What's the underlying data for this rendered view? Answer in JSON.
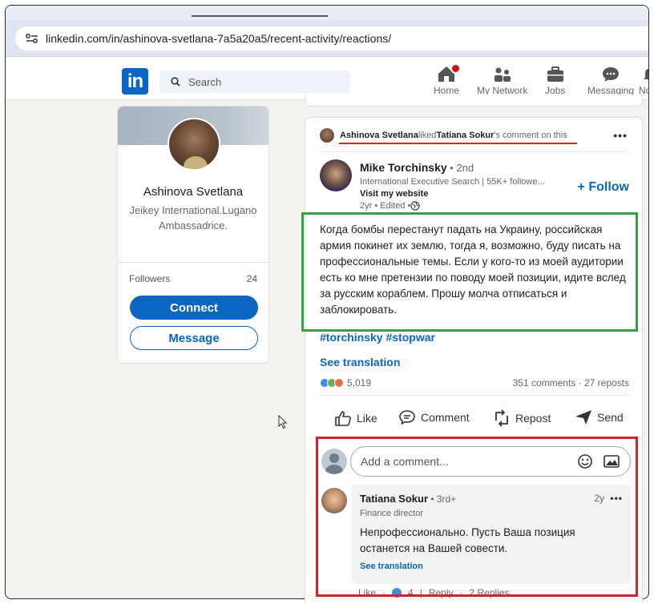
{
  "browser": {
    "url": "linkedin.com/in/ashinova-svetlana-7a5a20a5/recent-activity/reactions/"
  },
  "nav": {
    "search_placeholder": "Search",
    "items": [
      {
        "label": "Home"
      },
      {
        "label": "My Network"
      },
      {
        "label": "Jobs"
      },
      {
        "label": "Messaging"
      },
      {
        "label": "Notif"
      }
    ]
  },
  "profile": {
    "name": "Ashinova Svetlana",
    "headline": "Jeikey International.Lugano Ambassadrice.",
    "followers_label": "Followers",
    "followers_count": "24",
    "connect_label": "Connect",
    "message_label": "Message"
  },
  "post": {
    "activity": {
      "actor": "Ashinova Svetlana",
      "verb": " liked ",
      "target": "Tatiana Sokur",
      "suffix": "'s comment on this"
    },
    "author": {
      "name": "Mike Torchinsky",
      "degree": " • 2nd",
      "subtitle": "International Executive Search | 55K+ followe...",
      "website": "Visit my website",
      "time": "2yr • Edited • "
    },
    "follow_label": "+ Follow",
    "text": "Когда бомбы перестанут падать на Украину, российская армия покинет их землю, тогда я, возможно, буду писать на профессиональные темы. Если у кого-то из моей аудитории есть ко мне претензии по поводу моей позиции, идите вслед за русским кораблем. Прошу молча отписаться и заблокировать.",
    "hashtags": "#torchinsky #stopwar",
    "see_translation": "See translation",
    "reactions_count": "5,019",
    "comments_reposts": "351 comments · 27 reposts",
    "actions": {
      "like": "Like",
      "comment": "Comment",
      "repost": "Repost",
      "send": "Send"
    },
    "comment_placeholder": "Add a comment...",
    "reply": {
      "name": "Tatiana Sokur",
      "degree": " • 3rd+",
      "time": "2y",
      "role": "Finance director",
      "text": "Непрофессионально. Пусть Ваша позиция останется на Вашей совести.",
      "see_translation": "See translation",
      "like_label": "Like",
      "like_count": "4",
      "reply_label": "Reply",
      "replies": "2 Replies"
    }
  },
  "colors": {
    "brand": "#0a66c2",
    "highlight_green": "#2fa24b",
    "highlight_red": "#d0232b"
  }
}
